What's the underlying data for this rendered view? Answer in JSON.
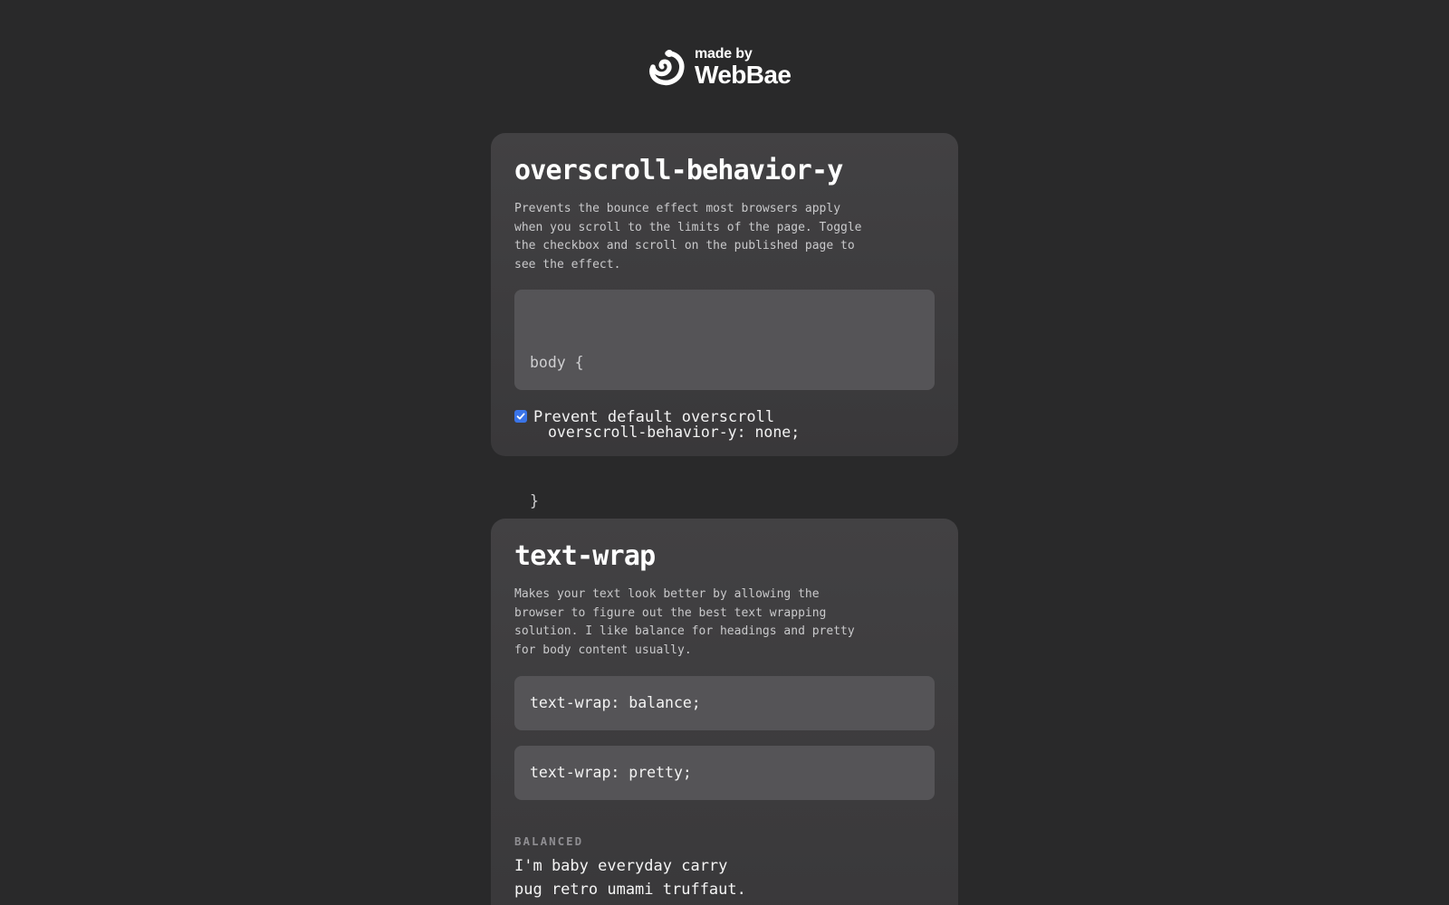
{
  "logo": {
    "made_by": "made by",
    "brand": "WebBae"
  },
  "cards": [
    {
      "title": "overscroll-behavior-y",
      "description": "Prevents the bounce effect most browsers apply\nwhen you scroll to the limits of the page. Toggle\nthe checkbox and scroll on the published page to\nsee the effect.",
      "code": {
        "line1": "body {",
        "line2": "overscroll-behavior-y: none;",
        "line3": "}"
      },
      "checkbox": {
        "label": "Prevent default overscroll",
        "checked": true
      }
    },
    {
      "title": "text-wrap",
      "description": "Makes your text look better by allowing the\nbrowser to figure out the best text wrapping\nsolution. I like balance for headings and pretty\nfor body content usually.",
      "code_balance": "text-wrap: balance;",
      "code_pretty": "text-wrap: pretty;",
      "section_label": "BALANCED",
      "sample_text": "I'm baby everyday carry\npug retro umami truffaut."
    }
  ],
  "colors": {
    "background": "#29292a",
    "card": "#3f3e40",
    "code_block": "#555457",
    "checkbox_accent": "#3a74e8"
  }
}
